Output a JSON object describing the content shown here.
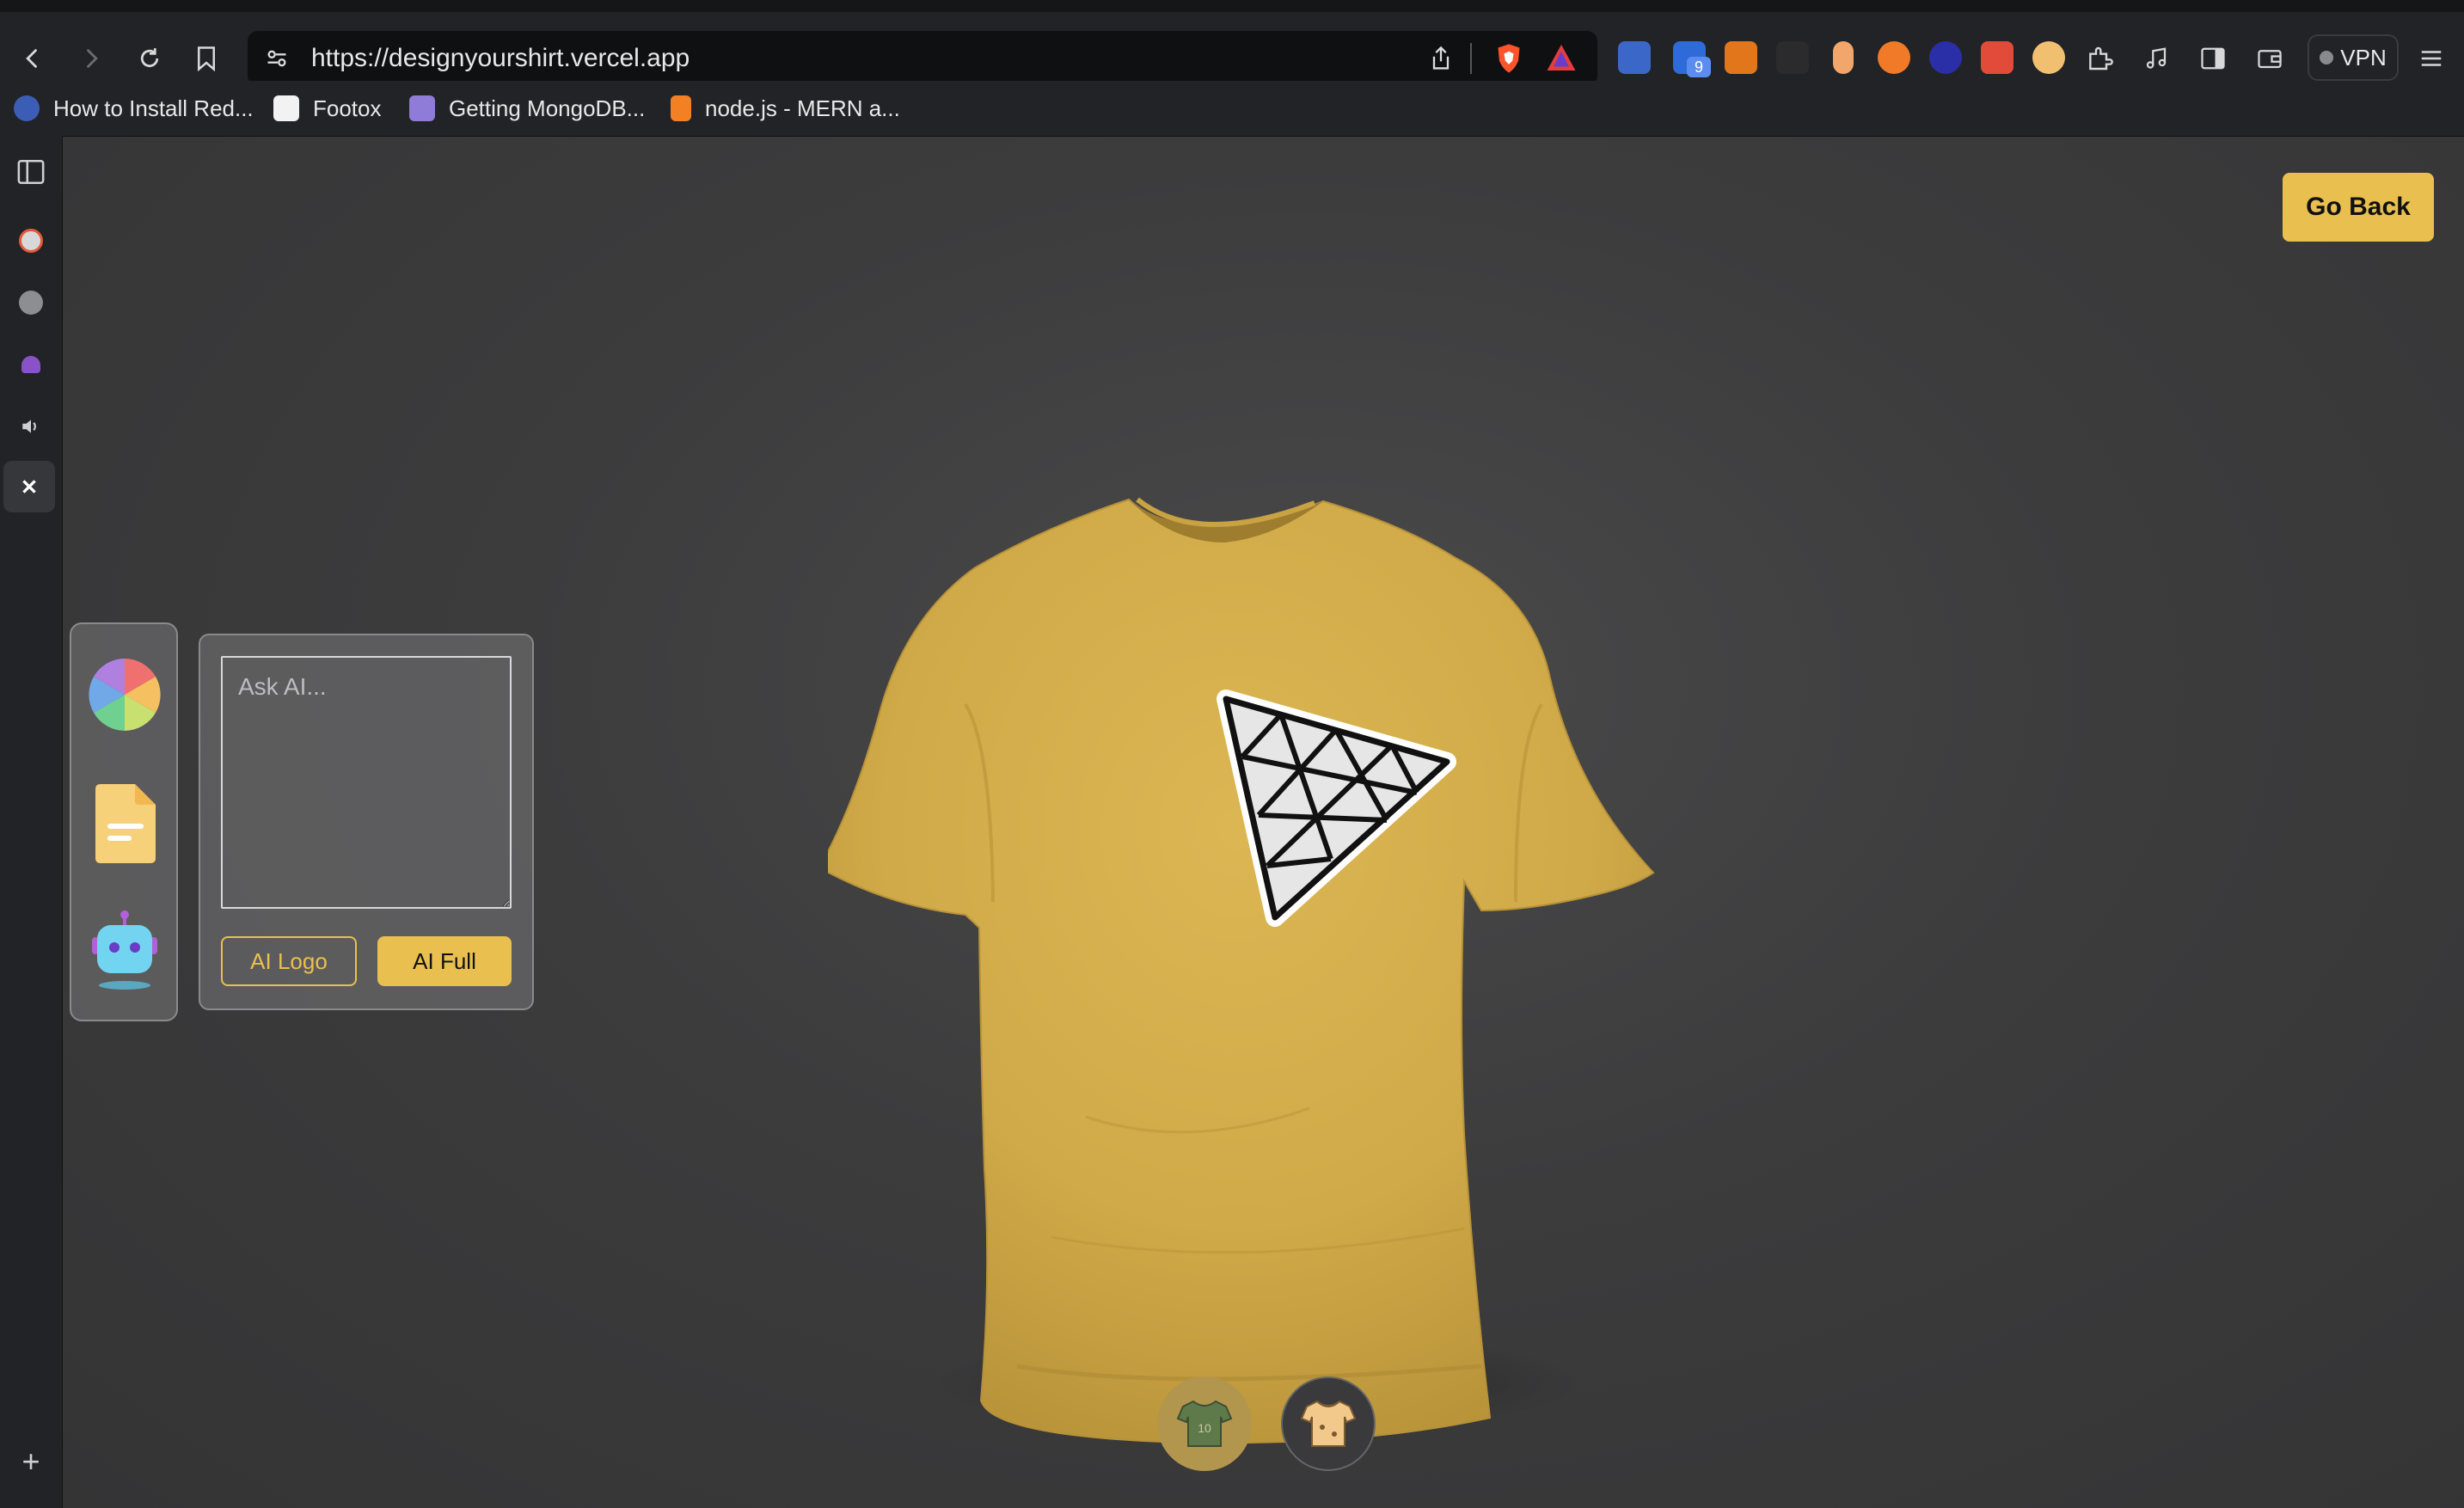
{
  "browser": {
    "url": "https://designyourshirt.vercel.app",
    "vpn_label": "VPN",
    "extension_badge": "9",
    "bookmarks": [
      {
        "label": "How to Install Red..."
      },
      {
        "label": "Footox"
      },
      {
        "label": "Getting MongoDB..."
      },
      {
        "label": "node.js - MERN a..."
      }
    ]
  },
  "sidebar": {
    "icons": [
      "panel-toggle-icon",
      "brave-news-icon",
      "globe-icon",
      "octopus-icon",
      "speaker-icon",
      "close-icon"
    ],
    "add_label": "+"
  },
  "app": {
    "go_back_label": "Go Back",
    "tools": [
      "color-picker-tool",
      "file-picker-tool",
      "ai-picker-tool"
    ],
    "ai_prompt_placeholder": "Ask AI...",
    "ai_logo_label": "AI Logo",
    "ai_full_label": "AI Full",
    "shirt_color": "#d8b04d",
    "accent_color": "#e9c04f",
    "filter_tabs": [
      "logo-shirt-filter",
      "stylish-shirt-filter"
    ]
  }
}
